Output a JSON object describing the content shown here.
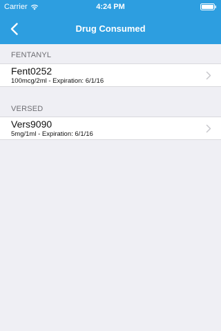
{
  "status_bar": {
    "carrier": "Carrier",
    "time": "4:24 PM",
    "wifi_icon": "wifi-icon",
    "battery_icon": "battery-icon"
  },
  "nav": {
    "title": "Drug Consumed",
    "back_icon": "chevron-left-icon"
  },
  "sections": [
    {
      "header": "FENTANYL",
      "items": [
        {
          "title": "Fent0252",
          "subtitle": "100mcg/2ml - Expiration: 6/1/16"
        }
      ]
    },
    {
      "header": "VERSED",
      "items": [
        {
          "title": "Vers9090",
          "subtitle": "5mg/1ml - Expiration: 6/1/16"
        }
      ]
    }
  ],
  "colors": {
    "nav_background": "#2d9ee0",
    "page_background": "#efeff4",
    "section_header_text": "#6d6d72",
    "chevron": "#c7c7cc"
  }
}
